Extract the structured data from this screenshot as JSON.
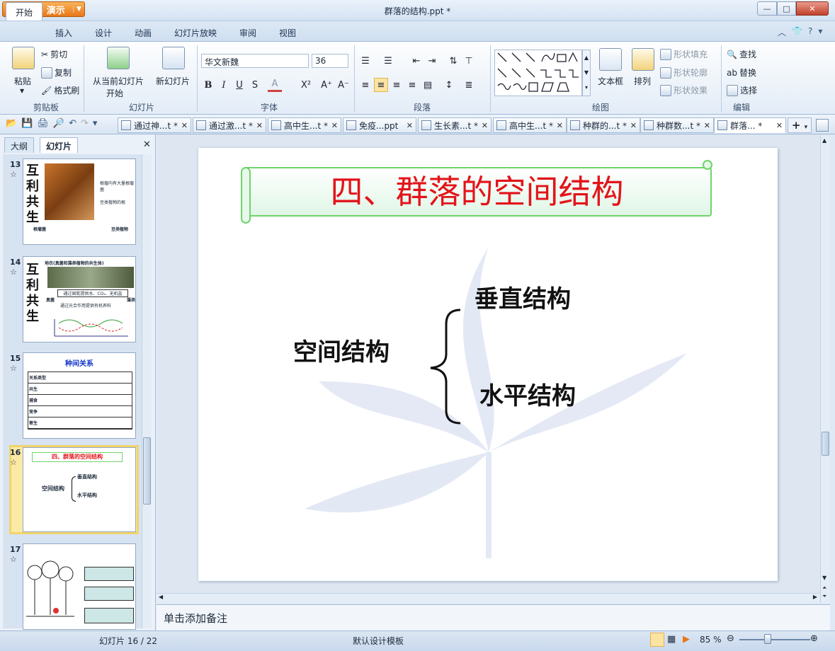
{
  "app": {
    "name": "WPS 演示",
    "window_title": "群落的结构.ppt *"
  },
  "menu_tabs": [
    "开始",
    "插入",
    "设计",
    "动画",
    "幻灯片放映",
    "审阅",
    "视图"
  ],
  "ribbon": {
    "clipboard": {
      "paste": "粘贴",
      "cut": "剪切",
      "copy": "复制",
      "format_painter": "格式刷",
      "label": "剪贴板"
    },
    "slides": {
      "from_current": "从当前幻灯片",
      "start": "开始",
      "new_slide": "新幻灯片",
      "label": "幻灯片"
    },
    "font": {
      "family": "华文新魏",
      "size": "36",
      "bold": "B",
      "italic": "I",
      "underline": "U",
      "strike": "S",
      "color": "A",
      "superscript": "X²",
      "grow": "A⁺",
      "shrink": "A⁻",
      "label": "字体"
    },
    "paragraph": {
      "label": "段落"
    },
    "drawing": {
      "textbox": "文本框",
      "arrange": "排列",
      "fill": "形状填充",
      "outline": "形状轮廓",
      "effect": "形状效果",
      "label": "绘图"
    },
    "editing": {
      "find": "查找",
      "replace": "替换",
      "select": "选择",
      "label": "编辑"
    }
  },
  "doc_tabs": [
    "通过神...t *",
    "通过激...t *",
    "高中生...t *",
    "免疫...ppt",
    "生长素...t *",
    "高中生...t *",
    "种群的...t *",
    "种群数...t *",
    "群落... *"
  ],
  "panel": {
    "tab_outline": "大纲",
    "tab_slides": "幻灯片"
  },
  "thumbnails": [
    {
      "num": "13",
      "title": "互利共生",
      "lines": [
        "根瘤内有大量根瘤菌",
        "豆类植物的根",
        "根瘤菌",
        "豆类植物"
      ]
    },
    {
      "num": "14",
      "title": "互利共生",
      "lines": [
        "地衣(真菌和藻类植物的共生体)",
        "通过固氮提供水、CO₂、无机盐",
        "真菌",
        "藻类",
        "通过光合作用提供有机养料"
      ]
    },
    {
      "num": "15",
      "title": "种间关系",
      "lines": [
        "关系类型",
        "共生",
        "捕食",
        "竞争",
        "寄生"
      ]
    },
    {
      "num": "16",
      "title": "四、群落的空间结构",
      "lines": [
        "空间结构",
        "垂直结构",
        "水平结构"
      ]
    },
    {
      "num": "17",
      "title": "",
      "lines": []
    }
  ],
  "slide": {
    "title": "四、群落的空间结构",
    "left": "空间结构",
    "top_item": "垂直结构",
    "bottom_item": "水平结构"
  },
  "notes_placeholder": "单击添加备注",
  "status": {
    "slide_count": "幻灯片 16 / 22",
    "template": "默认设计模板",
    "zoom": "85 %"
  },
  "colors": {
    "title_red": "#e3141a",
    "banner_green": "#6fd46a",
    "accent": "#e8761a"
  }
}
